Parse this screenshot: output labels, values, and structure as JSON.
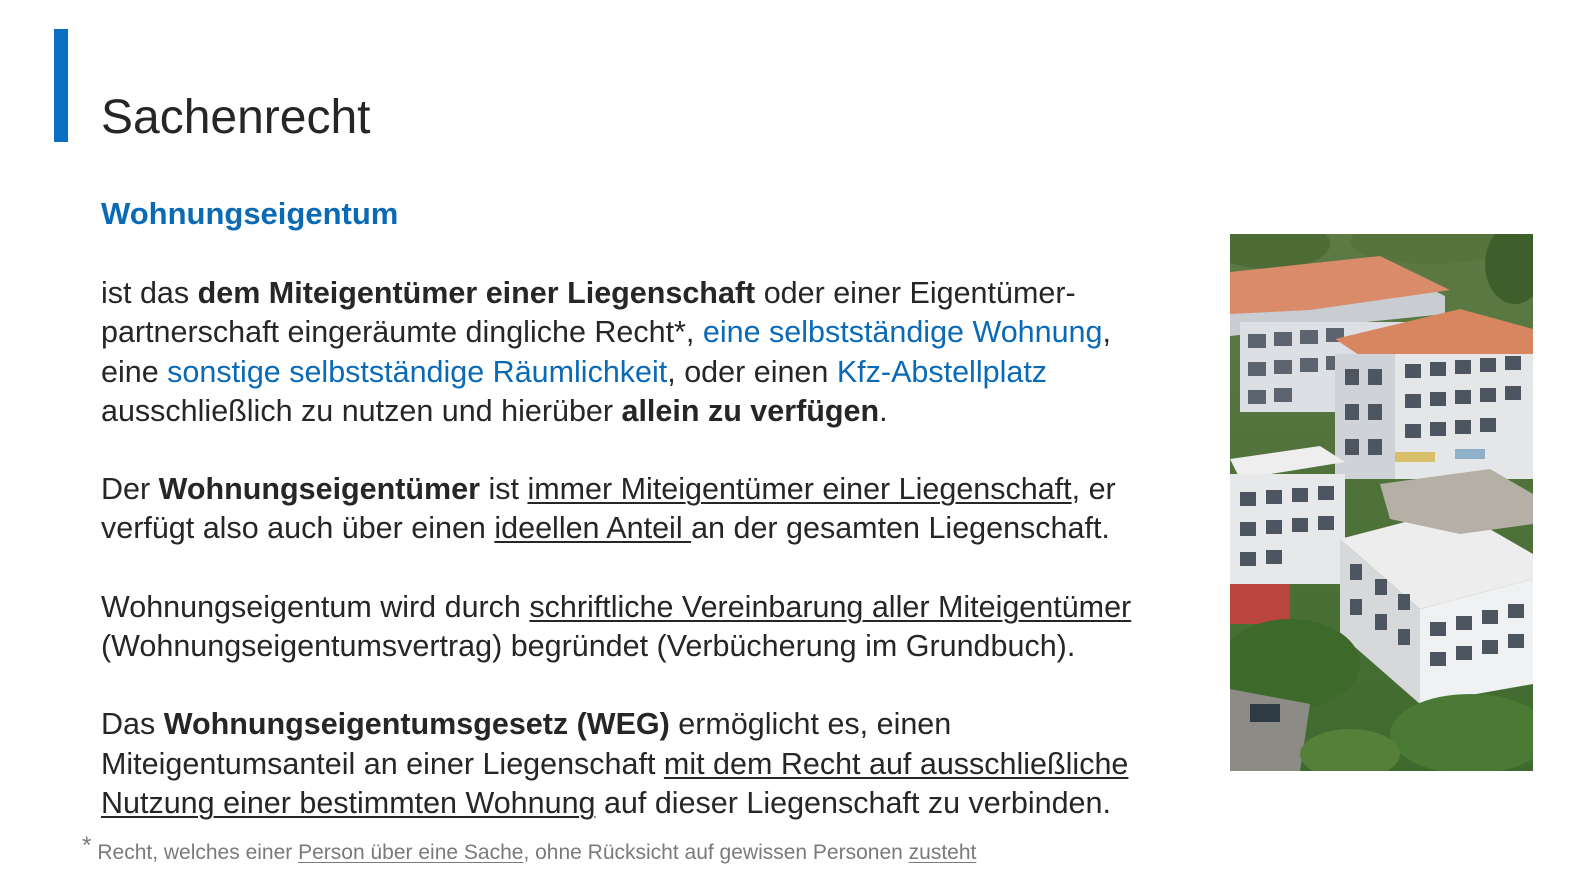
{
  "slide": {
    "title": "Sachenrecht",
    "subtitle": "Wohnungseigentum"
  },
  "paragraphs": {
    "p1": {
      "t1": "ist das ",
      "b1": "dem Miteigentümer einer Liegenschaft",
      "t2": " oder einer Eigentümer-",
      "t3": "partnerschaft eingeräumte dingliche Recht*, ",
      "h1": "eine selbstständige Wohnung",
      "t4": ",",
      "t5": "eine ",
      "h2": "sonstige selbstständige Räumlichkeit",
      "t6": ", oder einen ",
      "h3": "Kfz-Abstellplatz",
      "t7": "ausschließlich zu nutzen und hierüber ",
      "b2": "allein zu verfügen",
      "t8": "."
    },
    "p2": {
      "t1": "Der ",
      "b1": "Wohnungseigentümer",
      "t2": " ist ",
      "u1": "immer Miteigentümer einer Liegenschaft",
      "t3": ", er",
      "t4": "verfügt also auch über einen ",
      "u2": "ideellen Anteil ",
      "t5": "an der gesamten Liegenschaft."
    },
    "p3": {
      "t1": "Wohnungseigentum wird durch ",
      "u1": "schriftliche Vereinbarung aller Miteigentümer",
      "t2": "(Wohnungseigentumsvertrag) begründet (Verbücherung im Grundbuch)."
    },
    "p4": {
      "t1": "Das ",
      "b1": "Wohnungseigentumsgesetz (WEG)",
      "t2": " ermöglicht es, einen",
      "t3": "Miteigentumsanteil an einer Liegenschaft ",
      "u1": "mit dem Recht auf ausschließliche",
      "u2": "Nutzung einer bestimmten Wohnung",
      "t4": " auf dieser Liegenschaft zu verbinden."
    }
  },
  "footnote": {
    "star": "*",
    "t1": "Recht, welches einer ",
    "u1": "Person über eine Sache",
    "t2": ", ohne Rücksicht auf gewissen Personen ",
    "u2": "zusteht"
  },
  "colors": {
    "accent": "#0a6fc2",
    "heading_blue": "#0b6ab6",
    "text": "#262626",
    "footnote": "#7a7a7a"
  }
}
